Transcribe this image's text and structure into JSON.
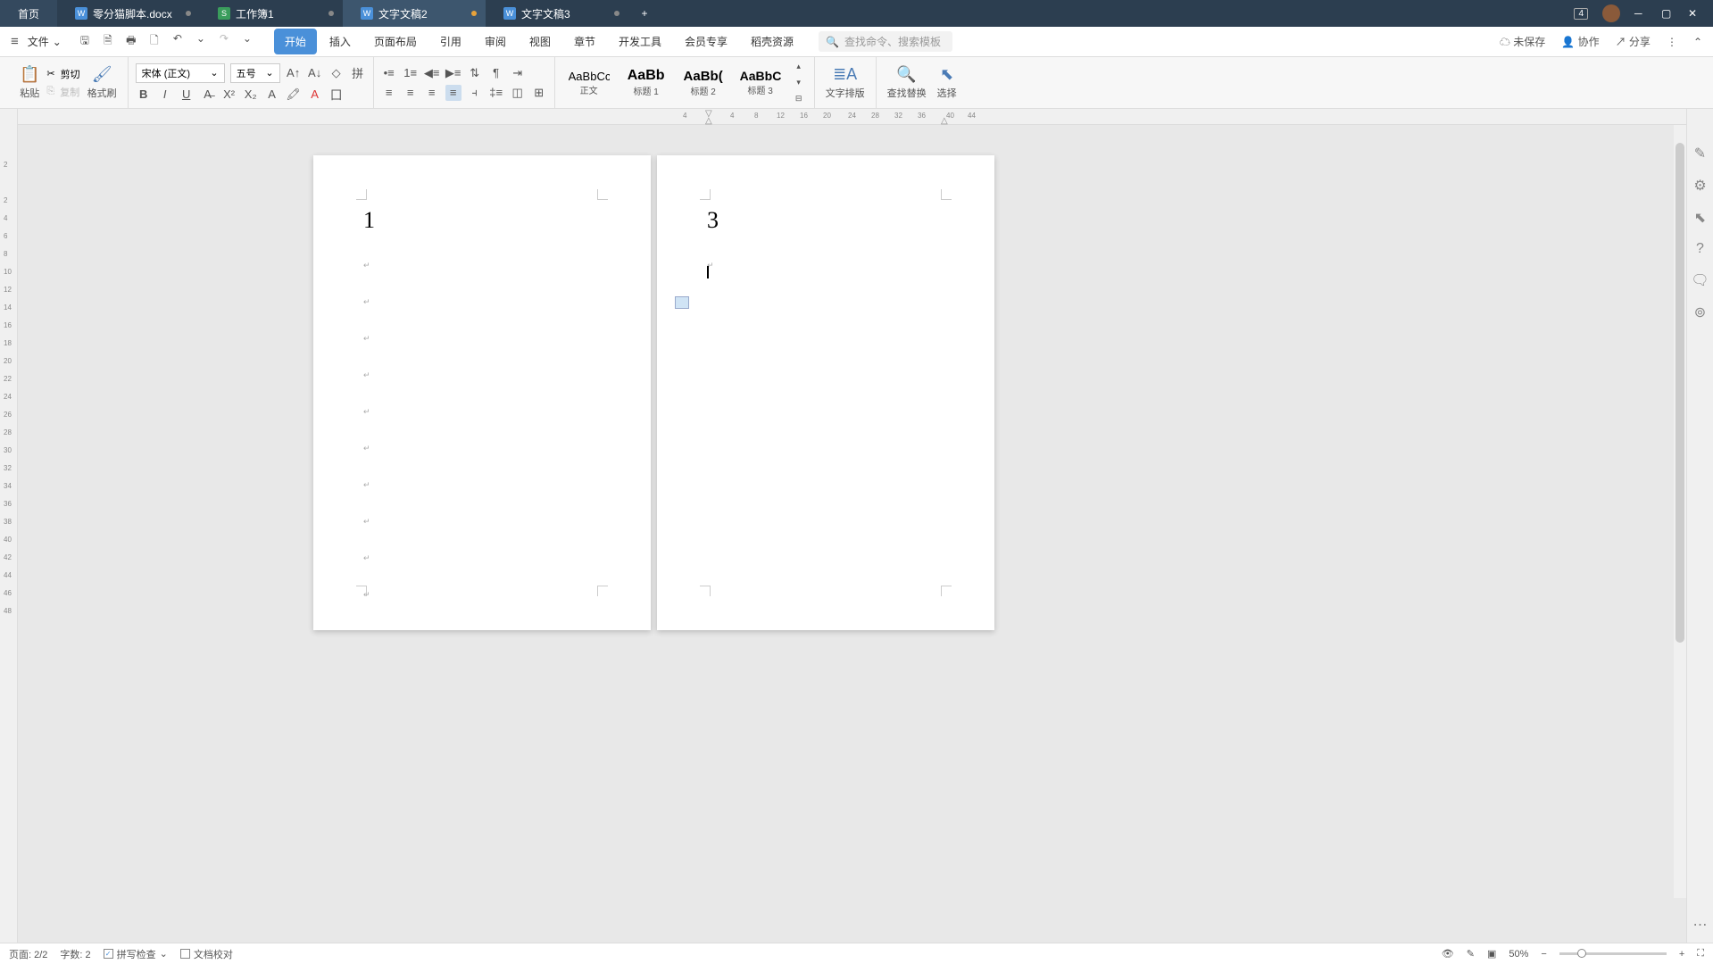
{
  "titlebar": {
    "home": "首页",
    "tabs": [
      {
        "name": "零分猫脚本.docx",
        "type": "doc",
        "dot": "gray"
      },
      {
        "name": "工作簿1",
        "type": "xls",
        "dot": "gray"
      },
      {
        "name": "文字文稿2",
        "type": "doc",
        "dot": "orange",
        "active": true
      },
      {
        "name": "文字文稿3",
        "type": "doc",
        "dot": "gray"
      }
    ],
    "badge": "4"
  },
  "menubar": {
    "file": "文件",
    "tabs": [
      "开始",
      "插入",
      "页面布局",
      "引用",
      "审阅",
      "视图",
      "章节",
      "开发工具",
      "会员专享",
      "稻壳资源"
    ],
    "search_placeholder": "查找命令、搜索模板",
    "unsaved": "未保存",
    "collab": "协作",
    "share": "分享"
  },
  "ribbon": {
    "paste": "粘贴",
    "cut": "剪切",
    "copy": "复制",
    "format_painter": "格式刷",
    "font_name": "宋体 (正文)",
    "font_size": "五号",
    "styles": [
      {
        "preview": "AaBbCcDd",
        "label": "正文",
        "weight": "normal"
      },
      {
        "preview": "AaBb",
        "label": "标题 1",
        "weight": "bold"
      },
      {
        "preview": "AaBb(",
        "label": "标题 2",
        "weight": "bold"
      },
      {
        "preview": "AaBbC(",
        "label": "标题 3",
        "weight": "bold"
      }
    ],
    "text_layout": "文字排版",
    "find_replace": "查找替换",
    "select": "选择"
  },
  "hruler": [
    "4",
    "4",
    "8",
    "12",
    "16",
    "20",
    "24",
    "28",
    "32",
    "36",
    "40",
    "44"
  ],
  "vruler": [
    "2",
    "2",
    "4",
    "6",
    "8",
    "10",
    "12",
    "14",
    "16",
    "18",
    "20",
    "22",
    "24",
    "26",
    "28",
    "30",
    "32",
    "34",
    "36",
    "38",
    "40",
    "42",
    "44",
    "46",
    "48"
  ],
  "document": {
    "page1_heading": "1",
    "page2_heading": "3"
  },
  "statusbar": {
    "page": "页面: 2/2",
    "words": "字数: 2",
    "spellcheck": "拼写检查",
    "proofread": "文档校对",
    "zoom": "50%"
  }
}
